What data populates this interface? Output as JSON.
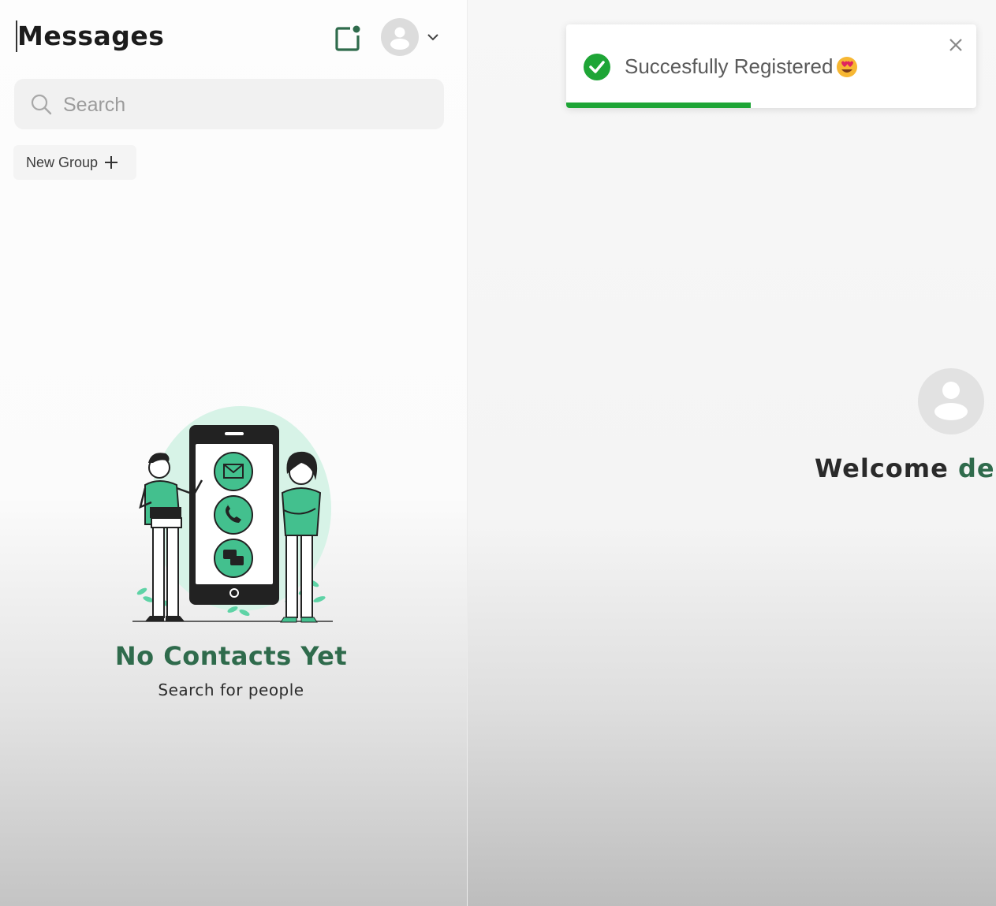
{
  "sidebar": {
    "title": "Messages",
    "compose_icon": "new-chat-icon",
    "avatar_icon": "user-avatar-icon",
    "dropdown_icon": "chevron-down-icon",
    "search": {
      "placeholder": "Search",
      "value": "",
      "icon": "search-icon"
    },
    "new_group": {
      "label": "New Group",
      "icon": "plus-icon"
    },
    "empty_state": {
      "illustration": "people-phone-illustration",
      "title": "No Contacts Yet",
      "subtitle": "Search for people"
    }
  },
  "toast": {
    "icon": "check-circle-icon",
    "message": "Succesfully Registered",
    "emoji": "heart-eyes-emoji",
    "close_icon": "close-icon",
    "progress": 0.45
  },
  "main": {
    "avatar_icon": "user-avatar-icon",
    "welcome_prefix": "Welcome",
    "welcome_name": "dem"
  },
  "colors": {
    "accent_green": "#2f6b4c",
    "success_green": "#1ea536",
    "illustration_mint": "#5fd3a6",
    "dark_text": "#1c1c1c"
  }
}
